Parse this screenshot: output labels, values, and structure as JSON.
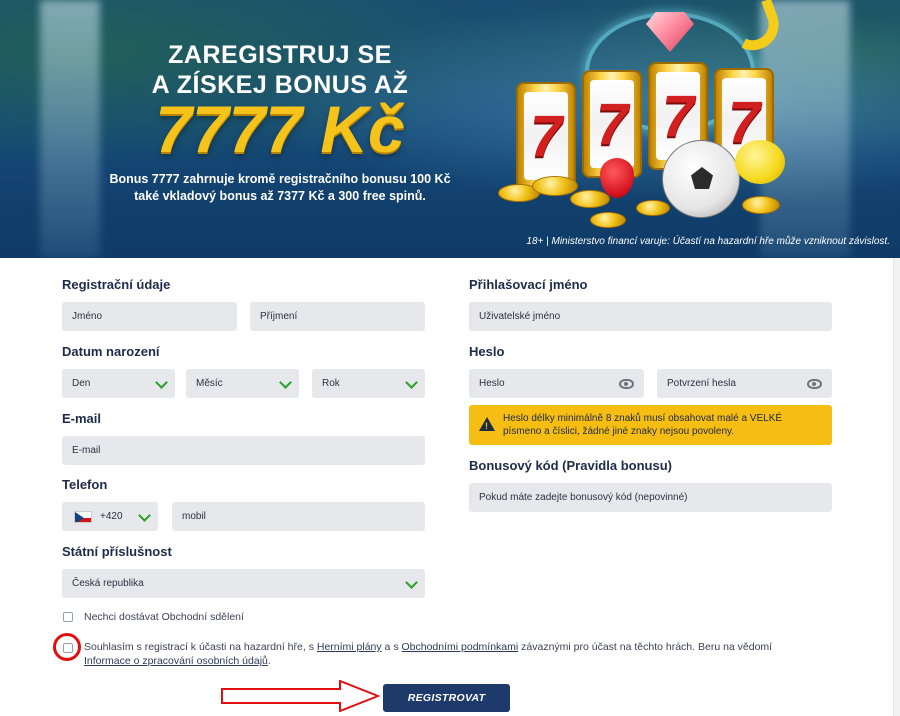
{
  "banner": {
    "headline_line1": "ZAREGISTRUJ SE",
    "headline_line2": "A ZÍSKEJ BONUS AŽ",
    "amount": "7777 Kč",
    "sub_line1": "Bonus 7777 zahrnuje kromě registračního bonusu 100 Kč",
    "sub_line2": "také vkladový bonus až 7377 Kč a 300 free spinů.",
    "disclaimer": "18+ | Ministerstvo financí varuje: Účastí na hazardní hře může vzniknout závislost.",
    "reel_symbol": "7"
  },
  "form": {
    "registration_label": "Registrační údaje",
    "first_name_placeholder": "Jméno",
    "last_name_placeholder": "Příjmení",
    "birthdate_label": "Datum narození",
    "day_select": "Den",
    "month_select": "Měsíc",
    "year_select": "Rok",
    "email_label": "E-mail",
    "email_placeholder": "E-mail",
    "phone_label": "Telefon",
    "phone_prefix": "+420",
    "phone_placeholder": "mobil",
    "nationality_label": "Státní příslušnost",
    "nationality_value": "Česká republika",
    "username_label": "Přihlašovací jméno",
    "username_placeholder": "Uživatelské jméno",
    "password_label": "Heslo",
    "password_placeholder": "Heslo",
    "password_confirm_placeholder": "Potvrzení hesla",
    "password_warning_line1": "Heslo délky minimálně 8 znaků musí obsahovat malé a VELKÉ",
    "password_warning_line2": "písmeno a číslici, žádné jiné znaky nejsou povoleny.",
    "bonus_label": "Bonusový kód (Pravidla bonusu)",
    "bonus_placeholder": "Pokud máte zadejte bonusový kód (nepovinné)",
    "newsletter_optout": "Nechci dostávat Obchodní sdělení",
    "consent_pre": "Souhlasím s registrací k účasti na hazardní hře, s ",
    "consent_link1": "Herními plány",
    "consent_mid": " a s ",
    "consent_link2": "Obchodními podmínkami",
    "consent_post": " závaznými pro účast na těchto hrách. Beru na vědomí",
    "consent_link3": "Informace o zpracování osobních údajů",
    "consent_end": ".",
    "submit_label": "REGISTROVAT"
  },
  "colors": {
    "accent_navy": "#1d3a6a",
    "warning_yellow": "#f6bd12",
    "chevron_green": "#26a326",
    "annotation_red": "#e01010"
  },
  "icons": [
    "chevron-down-icon",
    "eye-icon",
    "warning-icon",
    "czech-flag-icon",
    "arrow-annotation-icon"
  ]
}
